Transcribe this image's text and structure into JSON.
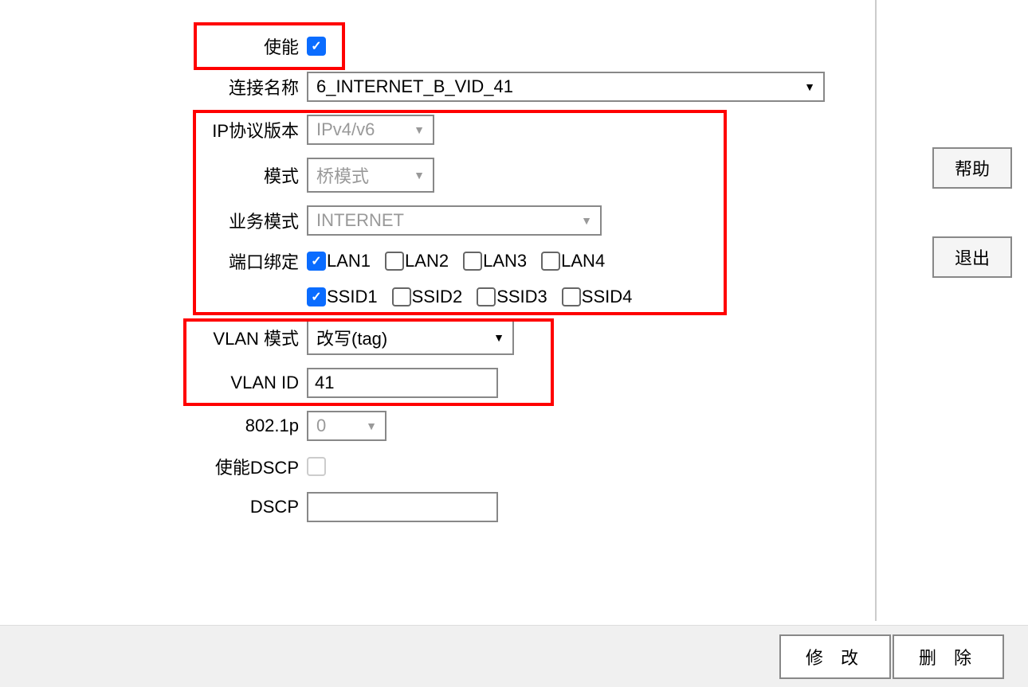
{
  "form": {
    "enable": {
      "label": "使能",
      "checked": true
    },
    "connection_name": {
      "label": "连接名称",
      "value": "6_INTERNET_B_VID_41"
    },
    "ip_protocol": {
      "label": "IP协议版本",
      "value": "IPv4/v6"
    },
    "mode": {
      "label": "模式",
      "value": "桥模式"
    },
    "service_mode": {
      "label": "业务模式",
      "value": "INTERNET"
    },
    "port_binding": {
      "label": "端口绑定",
      "lan": [
        {
          "label": "LAN1",
          "checked": true
        },
        {
          "label": "LAN2",
          "checked": false
        },
        {
          "label": "LAN3",
          "checked": false
        },
        {
          "label": "LAN4",
          "checked": false
        }
      ],
      "ssid": [
        {
          "label": "SSID1",
          "checked": true
        },
        {
          "label": "SSID2",
          "checked": false
        },
        {
          "label": "SSID3",
          "checked": false
        },
        {
          "label": "SSID4",
          "checked": false
        }
      ]
    },
    "vlan_mode": {
      "label": "VLAN 模式",
      "value": "改写(tag)"
    },
    "vlan_id": {
      "label": "VLAN ID",
      "value": "41"
    },
    "dot1p": {
      "label": "802.1p",
      "value": "0"
    },
    "enable_dscp": {
      "label": "使能DSCP",
      "checked": false
    },
    "dscp": {
      "label": "DSCP",
      "value": ""
    }
  },
  "side": {
    "help": "帮助",
    "exit": "退出"
  },
  "footer": {
    "modify": "修 改",
    "delete": "删 除"
  }
}
